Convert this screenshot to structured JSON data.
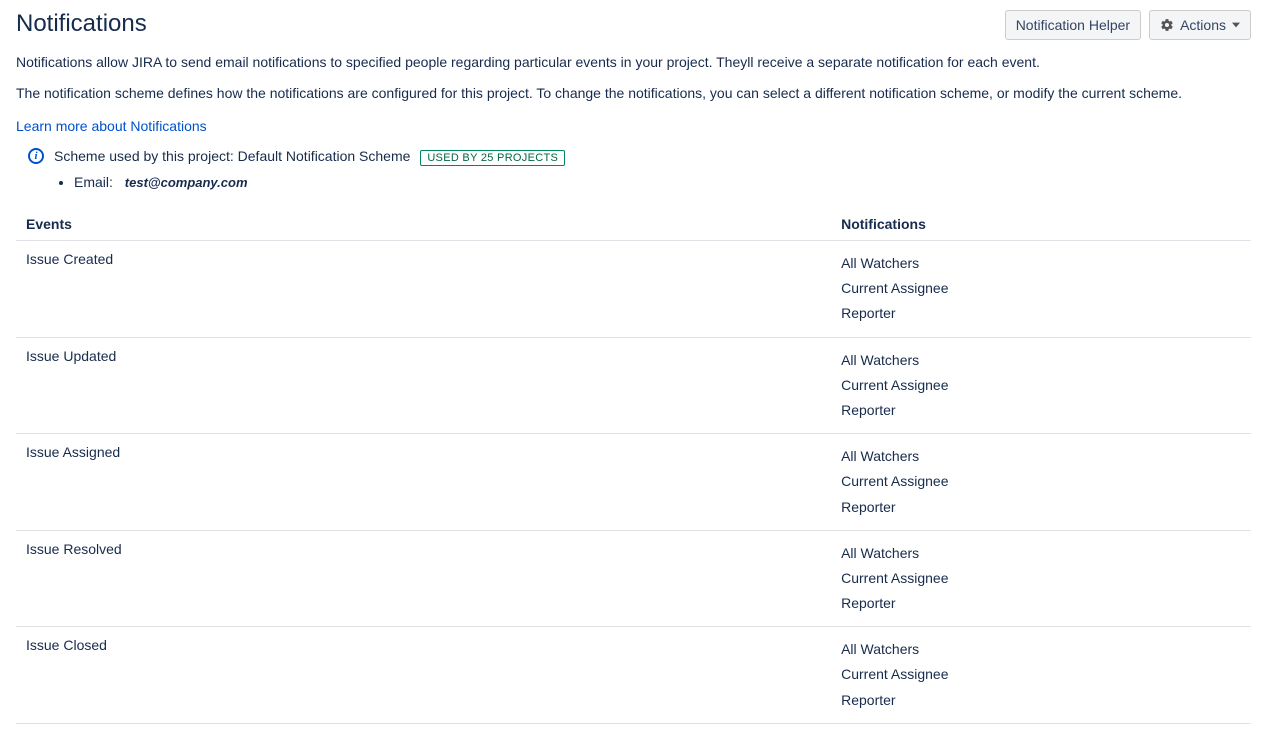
{
  "header": {
    "title": "Notifications",
    "helper_button": "Notification Helper",
    "actions_button": "Actions"
  },
  "intro": {
    "p1": "Notifications allow JIRA to send email notifications to specified people regarding particular events in your project. Theyll receive a separate notification for each event.",
    "p2": "The notification scheme defines how the notifications are configured for this project. To change the notifications, you can select a different notification scheme, or modify the current scheme.",
    "learn_more": "Learn more about Notifications"
  },
  "scheme": {
    "label": "Scheme used by this project:",
    "name": "Default Notification Scheme",
    "usage_badge": "USED BY 25 PROJECTS"
  },
  "email": {
    "label": "Email:",
    "value": "test@company.com"
  },
  "table": {
    "col_events": "Events",
    "col_notifications": "Notifications",
    "rows": [
      {
        "event": "Issue Created",
        "recipients": [
          "All Watchers",
          "Current Assignee",
          "Reporter"
        ]
      },
      {
        "event": "Issue Updated",
        "recipients": [
          "All Watchers",
          "Current Assignee",
          "Reporter"
        ]
      },
      {
        "event": "Issue Assigned",
        "recipients": [
          "All Watchers",
          "Current Assignee",
          "Reporter"
        ]
      },
      {
        "event": "Issue Resolved",
        "recipients": [
          "All Watchers",
          "Current Assignee",
          "Reporter"
        ]
      },
      {
        "event": "Issue Closed",
        "recipients": [
          "All Watchers",
          "Current Assignee",
          "Reporter"
        ]
      }
    ]
  }
}
